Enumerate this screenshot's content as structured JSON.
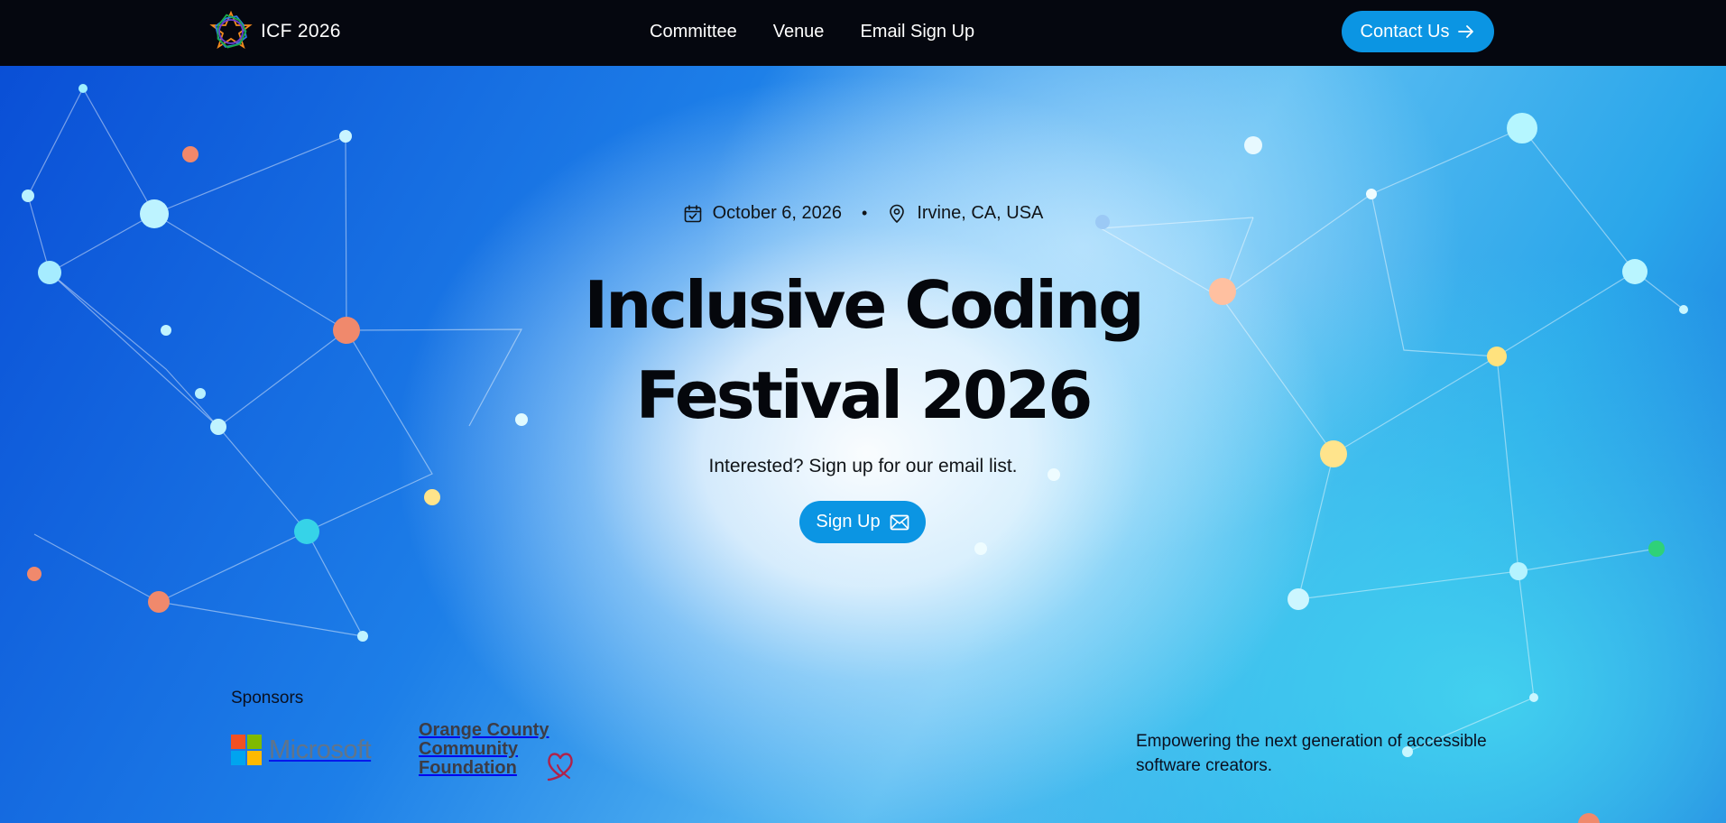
{
  "header": {
    "brand_name": "ICF 2026",
    "nav": [
      {
        "label": "Committee"
      },
      {
        "label": "Venue"
      },
      {
        "label": "Email Sign Up"
      }
    ],
    "contact_label": "Contact Us",
    "contact_icon": "arrow-right-icon"
  },
  "hero": {
    "date": "October 6, 2026",
    "date_icon": "calendar-check-icon",
    "separator": "•",
    "location": "Irvine, CA, USA",
    "location_icon": "map-pin-icon",
    "title_line1": "Inclusive Coding",
    "title_line2": "Festival 2026",
    "subtitle": "Interested? Sign up for our email list.",
    "signup_label": "Sign Up",
    "signup_icon": "envelope-icon"
  },
  "sponsors": {
    "label": "Sponsors",
    "microsoft_name": "Microsoft",
    "occf_lines": [
      "Orange County",
      "Community",
      "Foundation"
    ]
  },
  "tagline": "Empowering the next generation of accessible software creators.",
  "colors": {
    "accent": "#0b95e3",
    "topbar": "#05070f",
    "ms_red": "#f25022",
    "ms_green": "#7fba00",
    "ms_blue": "#00a4ef",
    "ms_yellow": "#ffb900",
    "occf_heart": "#b0224a"
  }
}
